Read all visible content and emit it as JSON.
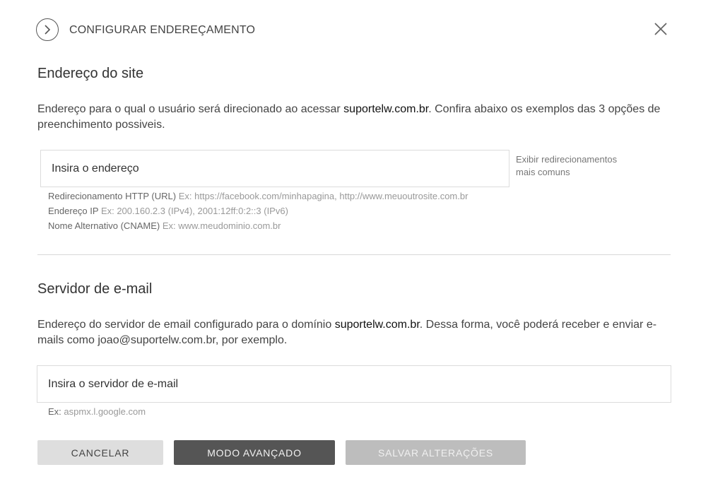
{
  "header": {
    "title": "CONFIGURAR ENDEREÇAMENTO"
  },
  "site": {
    "title": "Endereço do site",
    "desc_pre": "Endereço para o qual o usuário será direcionado ao acessar ",
    "desc_domain": "suportelw.com.br",
    "desc_post": ". Confira abaixo os exemplos das 3 opções de preenchimento possiveis.",
    "input_placeholder": "Insira o endereço",
    "side_link": "Exibir redirecionamentos mais comuns",
    "hints": [
      {
        "label": "Redirecionamento HTTP (URL)",
        "example": "Ex: https://facebook.com/minhapagina, http://www.meuoutrosite.com.br"
      },
      {
        "label": "Endereço IP",
        "example": "Ex: 200.160.2.3 (IPv4), 2001:12ff:0:2::3 (IPv6)"
      },
      {
        "label": "Nome Alternativo (CNAME)",
        "example": "Ex: www.meudominio.com.br"
      }
    ]
  },
  "email": {
    "title": "Servidor de e-mail",
    "desc_pre": "Endereço do servidor de email configurado para o domínio ",
    "desc_domain": "suportelw.com.br",
    "desc_post": ". Dessa forma, você poderá receber e enviar e-mails como joao@suportelw.com.br, por exemplo.",
    "input_placeholder": "Insira o servidor de e-mail",
    "hint_label": "Ex:",
    "hint_example": "aspmx.l.google.com"
  },
  "buttons": {
    "cancel": "CANCELAR",
    "advanced": "MODO AVANÇADO",
    "save": "SALVAR ALTERAÇÕES"
  }
}
